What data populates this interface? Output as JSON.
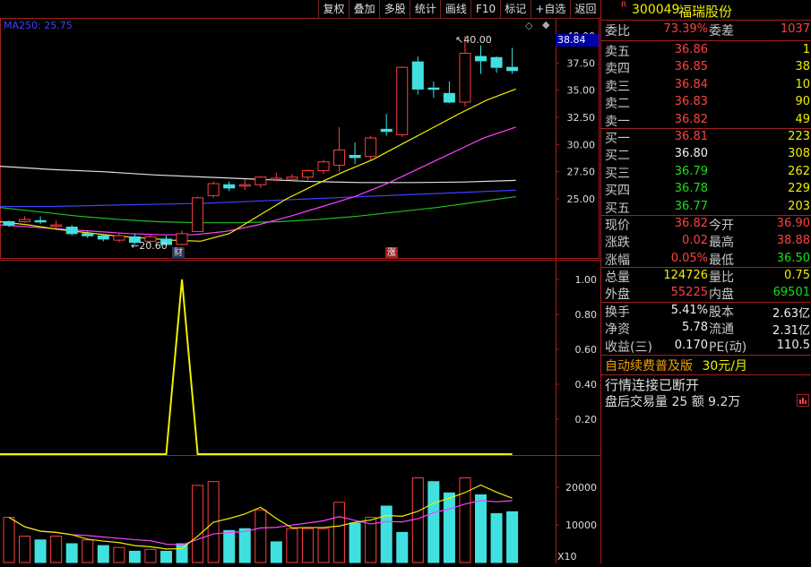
{
  "toolbar": [
    "复权",
    "叠加",
    "多股",
    "统计",
    "画线",
    "F10",
    "标记",
    "+自选",
    "返回"
  ],
  "chart_labels": {
    "ma_label": "MA250: 25.75",
    "current_price_tag": "38.84",
    "high_marker": "40.00",
    "low_marker": "20.60",
    "event_badge_1": "财",
    "event_badge_2": "涨",
    "vol_unit": "X10"
  },
  "colors": {
    "up": "#ff4040",
    "down": "#40e0e0",
    "ma_white": "#e0e0e0",
    "ma_yellow": "#f0f000",
    "ma_magenta": "#ff40ff",
    "ma_green": "#20c020",
    "ma_blue": "#4040ff",
    "frame": "#a02020"
  },
  "chart_data": [
    {
      "type": "candlestick",
      "y_ticks": [
        "40.00",
        "37.50",
        "35.00",
        "32.50",
        "30.00",
        "27.50",
        "25.00"
      ],
      "ylim": [
        19.5,
        41.0
      ],
      "candles": [
        {
          "o": 22.9,
          "c": 22.6,
          "h": 23.0,
          "l": 22.4
        },
        {
          "o": 22.9,
          "c": 23.1,
          "h": 23.4,
          "l": 22.8
        },
        {
          "o": 23.0,
          "c": 22.9,
          "h": 23.4,
          "l": 22.7
        },
        {
          "o": 22.6,
          "c": 22.6,
          "h": 23.0,
          "l": 22.3
        },
        {
          "o": 22.4,
          "c": 21.8,
          "h": 22.6,
          "l": 21.6
        },
        {
          "o": 21.8,
          "c": 21.6,
          "h": 22.0,
          "l": 21.4
        },
        {
          "o": 21.6,
          "c": 21.3,
          "h": 21.8,
          "l": 21.1
        },
        {
          "o": 21.2,
          "c": 21.6,
          "h": 21.9,
          "l": 21.0
        },
        {
          "o": 21.5,
          "c": 21.0,
          "h": 21.8,
          "l": 20.8
        },
        {
          "o": 21.1,
          "c": 21.5,
          "h": 21.7,
          "l": 20.9
        },
        {
          "o": 21.3,
          "c": 20.8,
          "h": 21.6,
          "l": 20.6
        },
        {
          "o": 20.8,
          "c": 21.8,
          "h": 22.1,
          "l": 20.7
        },
        {
          "o": 22.0,
          "c": 25.1,
          "h": 25.2,
          "l": 22.0
        },
        {
          "o": 25.3,
          "c": 26.4,
          "h": 26.6,
          "l": 25.1
        },
        {
          "o": 26.3,
          "c": 26.0,
          "h": 26.6,
          "l": 25.7
        },
        {
          "o": 26.2,
          "c": 26.3,
          "h": 26.8,
          "l": 25.8
        },
        {
          "o": 26.3,
          "c": 27.0,
          "h": 27.1,
          "l": 26.0
        },
        {
          "o": 26.8,
          "c": 26.9,
          "h": 27.4,
          "l": 26.6
        },
        {
          "o": 26.8,
          "c": 27.0,
          "h": 27.3,
          "l": 26.6
        },
        {
          "o": 27.0,
          "c": 27.6,
          "h": 27.7,
          "l": 26.7
        },
        {
          "o": 27.6,
          "c": 28.4,
          "h": 28.6,
          "l": 27.3
        },
        {
          "o": 28.1,
          "c": 29.5,
          "h": 31.6,
          "l": 27.5
        },
        {
          "o": 29.0,
          "c": 28.8,
          "h": 30.2,
          "l": 28.2
        },
        {
          "o": 28.9,
          "c": 30.6,
          "h": 30.8,
          "l": 28.6
        },
        {
          "o": 31.4,
          "c": 31.2,
          "h": 32.8,
          "l": 30.8
        },
        {
          "o": 30.9,
          "c": 37.1,
          "h": 37.2,
          "l": 30.7
        },
        {
          "o": 37.6,
          "c": 35.1,
          "h": 38.1,
          "l": 34.6
        },
        {
          "o": 35.2,
          "c": 35.1,
          "h": 35.8,
          "l": 34.3
        },
        {
          "o": 34.7,
          "c": 33.9,
          "h": 35.8,
          "l": 33.8
        },
        {
          "o": 33.9,
          "c": 38.4,
          "h": 40.0,
          "l": 33.5
        },
        {
          "o": 38.1,
          "c": 37.7,
          "h": 39.1,
          "l": 36.5
        },
        {
          "o": 38.0,
          "c": 37.1,
          "h": 38.1,
          "l": 36.6
        },
        {
          "o": 37.1,
          "c": 36.8,
          "h": 38.9,
          "l": 36.5
        }
      ],
      "ma_white": [
        28.0,
        27.7,
        27.5,
        27.2,
        27.0,
        26.8,
        26.6,
        26.5,
        26.5,
        26.55,
        26.7
      ],
      "ma_yellow": [
        22.9,
        22.6,
        22.2,
        21.9,
        21.6,
        21.4,
        21.2,
        21.1,
        21.8,
        23.4,
        25.0,
        26.3,
        27.5,
        28.6,
        30.0,
        31.4,
        32.8,
        34.1,
        35.1
      ],
      "ma_magenta": [
        22.6,
        22.4,
        22.2,
        22.0,
        21.8,
        21.7,
        21.7,
        22.0,
        22.6,
        23.4,
        24.3,
        25.2,
        26.4,
        27.8,
        29.2,
        30.6,
        31.6
      ],
      "ma_green": [
        24.2,
        23.8,
        23.4,
        23.1,
        22.9,
        22.8,
        22.8,
        22.9,
        23.1,
        23.4,
        23.8,
        24.2,
        24.7,
        25.2
      ],
      "ma_blue": [
        24.3,
        24.3,
        24.4,
        24.5,
        24.6,
        24.8,
        25.0,
        25.2,
        25.4,
        25.6,
        25.8
      ]
    },
    {
      "type": "line",
      "y_ticks": [
        "1.00",
        "0.80",
        "0.60",
        "0.40",
        "0.20"
      ],
      "ylim": [
        0,
        1.0
      ],
      "values": [
        0,
        0,
        0,
        0,
        0,
        0,
        0,
        0,
        0,
        0,
        0,
        1,
        0,
        0,
        0,
        0,
        0,
        0,
        0,
        0,
        0,
        0,
        0,
        0,
        0,
        0,
        0,
        0,
        0,
        0,
        0,
        0,
        0
      ]
    },
    {
      "type": "bar",
      "y_ticks": [
        "20000",
        "10000"
      ],
      "ylim": [
        0,
        24000
      ],
      "volumes": [
        12000,
        7000,
        6000,
        7000,
        5000,
        6000,
        4500,
        4000,
        3000,
        3500,
        3000,
        5000,
        20500,
        21500,
        8500,
        9000,
        14000,
        5500,
        9000,
        9000,
        9000,
        16000,
        10500,
        12000,
        15000,
        8000,
        22500,
        21500,
        18500,
        22500,
        18000,
        13000,
        13500
      ],
      "up": [
        1,
        1,
        0,
        1,
        0,
        1,
        0,
        1,
        0,
        1,
        0,
        0,
        1,
        1,
        0,
        0,
        1,
        0,
        1,
        1,
        1,
        1,
        0,
        1,
        0,
        0,
        1,
        0,
        0,
        1,
        0,
        0,
        0
      ]
    }
  ],
  "panel": {
    "code": "300049",
    "name": "福瑞股份",
    "r_mark": "R",
    "weibi": {
      "label": "委比",
      "value": "73.39%"
    },
    "weicha": {
      "label": "委差",
      "value": "1037"
    },
    "asks": [
      {
        "label": "卖五",
        "price": "36.86",
        "vol": "1"
      },
      {
        "label": "卖四",
        "price": "36.85",
        "vol": "38"
      },
      {
        "label": "卖三",
        "price": "36.84",
        "vol": "10"
      },
      {
        "label": "卖二",
        "price": "36.83",
        "vol": "90"
      },
      {
        "label": "卖一",
        "price": "36.82",
        "vol": "49"
      }
    ],
    "bids": [
      {
        "label": "买一",
        "price": "36.81",
        "vol": "223"
      },
      {
        "label": "买二",
        "price": "36.80",
        "vol": "308"
      },
      {
        "label": "买三",
        "price": "36.79",
        "vol": "262"
      },
      {
        "label": "买四",
        "price": "36.78",
        "vol": "229"
      },
      {
        "label": "买五",
        "price": "36.77",
        "vol": "203"
      }
    ],
    "quote": [
      {
        "l1": "现价",
        "v1": "36.82",
        "l2": "今开",
        "v2": "36.90"
      },
      {
        "l1": "涨跌",
        "v1": "0.02",
        "l2": "最高",
        "v2": "38.88"
      },
      {
        "l1": "涨幅",
        "v1": "0.05%",
        "l2": "最低",
        "v2": "36.50"
      }
    ],
    "volume": [
      {
        "l1": "总量",
        "v1": "124726",
        "l2": "量比",
        "v2": "0.75"
      },
      {
        "l1": "外盘",
        "v1": "55225",
        "l2": "内盘",
        "v2": "69501"
      }
    ],
    "fundamental": [
      {
        "l1": "换手",
        "v1": "5.41%",
        "l2": "股本",
        "v2": "2.63亿"
      },
      {
        "l1": "净资",
        "v1": "5.78",
        "l2": "流通",
        "v2": "2.31亿"
      },
      {
        "l1": "收益(三)",
        "v1": "0.170",
        "l2": "PE(动)",
        "v2": "110.5"
      }
    ],
    "promo": "自动续费普及版",
    "promo_price": "30元/月",
    "status1": "行情连接已断开",
    "status2": "盘后交易量 25 额 9.2万"
  }
}
